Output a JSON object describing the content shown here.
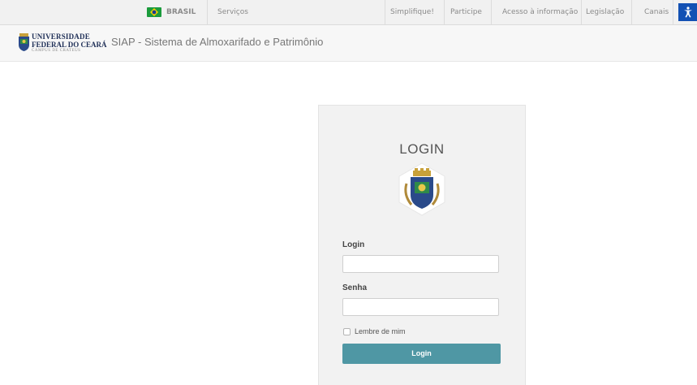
{
  "gov_bar": {
    "brasil": "BRASIL",
    "servicos": "Serviços",
    "simplifique": "Simplifique!",
    "participe": "Participe",
    "acesso": "Acesso à informação",
    "legislacao": "Legislação",
    "canais": "Canais",
    "accessibility_icon": "accessibility-icon"
  },
  "header": {
    "logo_line1": "UNIVERSIDADE",
    "logo_line2": "FEDERAL DO CEARÁ",
    "logo_line3": "CAMPUS DE CRATEUS",
    "app_title": "SIAP - Sistema de Almoxarifado e Patrimônio"
  },
  "login": {
    "title": "LOGIN",
    "login_label": "Login",
    "login_value": "",
    "senha_label": "Senha",
    "senha_value": "",
    "remember_label": "Lembre de mim",
    "remember_checked": false,
    "button_label": "Login"
  },
  "colors": {
    "button": "#4f97a4",
    "gov_blue": "#1351b4",
    "flag_green": "#1b9b3c"
  }
}
